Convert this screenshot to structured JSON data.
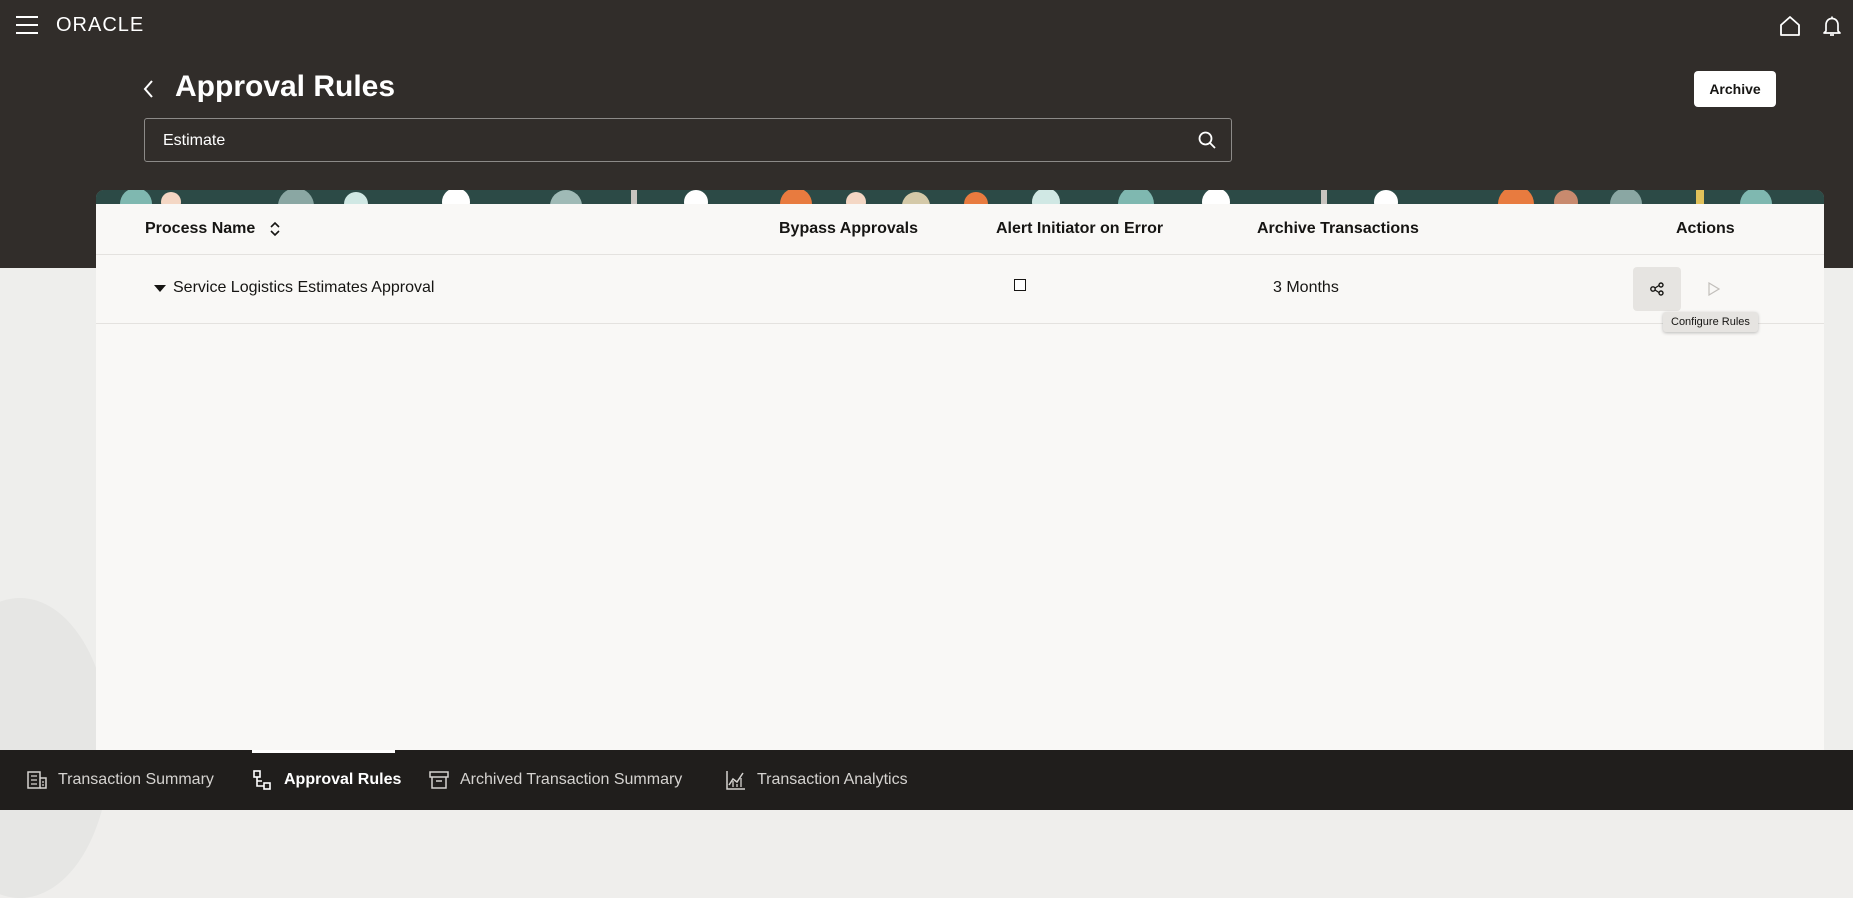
{
  "header": {
    "logo": "ORACLE",
    "page_title": "Approval Rules",
    "archive_label": "Archive"
  },
  "search": {
    "value": "Estimate"
  },
  "table": {
    "columns": {
      "process_name": "Process Name",
      "bypass_approvals": "Bypass Approvals",
      "alert_initiator": "Alert Initiator on Error",
      "archive_transactions": "Archive Transactions",
      "actions": "Actions"
    },
    "rows": [
      {
        "process_name": "Service Logistics Estimates Approval",
        "alert_initiator_checked": false,
        "archive_transactions": "3 Months"
      }
    ],
    "tooltip": "Configure Rules"
  },
  "bottom_nav": {
    "tabs": [
      {
        "label": "Transaction Summary",
        "icon": "table-icon",
        "active": false
      },
      {
        "label": "Approval Rules",
        "icon": "hierarchy-icon",
        "active": true
      },
      {
        "label": "Archived Transaction Summary",
        "icon": "archive-box-icon",
        "active": false
      },
      {
        "label": "Transaction Analytics",
        "icon": "chart-icon",
        "active": false
      }
    ]
  },
  "colors": {
    "header_bg": "#312d2a",
    "card_bg": "#f9f8f6",
    "bottom_nav_bg": "#201e1c",
    "banner_teal": "#2c4a46",
    "banner_orange": "#e87b3f"
  }
}
